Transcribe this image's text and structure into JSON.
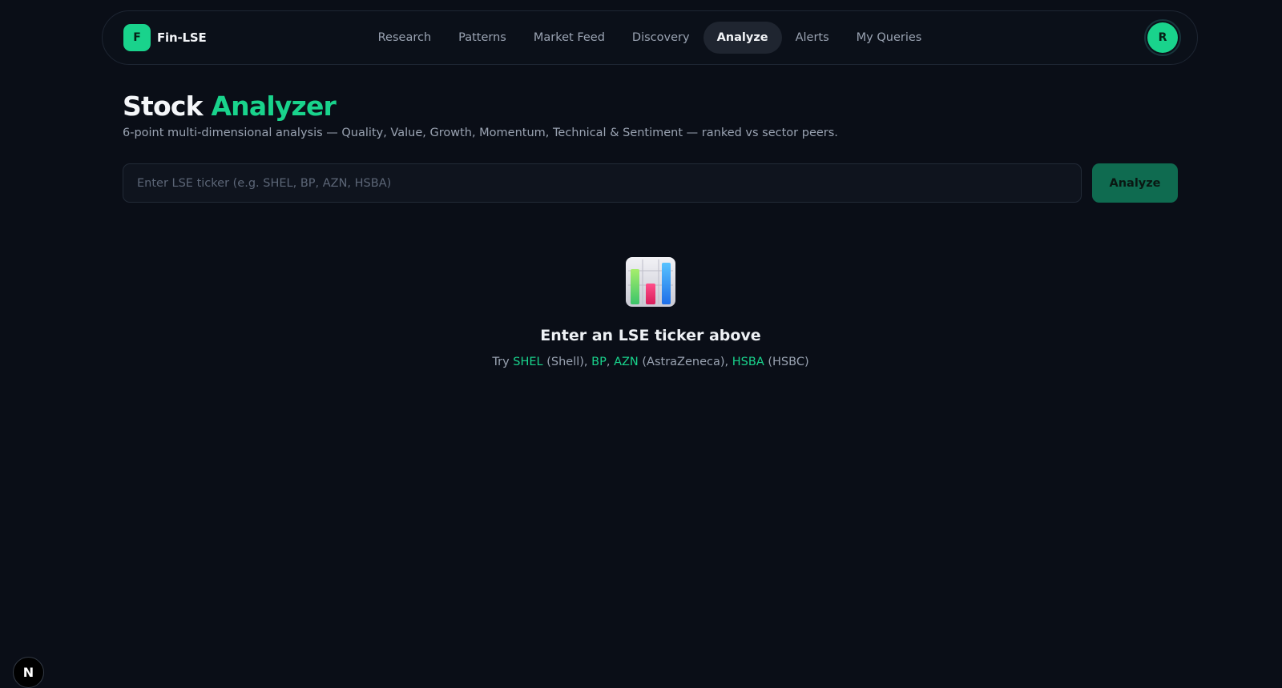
{
  "brand": {
    "badge": "F",
    "name": "Fin-LSE"
  },
  "nav": {
    "items": [
      {
        "label": "Research"
      },
      {
        "label": "Patterns"
      },
      {
        "label": "Market Feed"
      },
      {
        "label": "Discovery"
      },
      {
        "label": "Analyze",
        "active": true
      },
      {
        "label": "Alerts"
      },
      {
        "label": "My Queries"
      }
    ]
  },
  "user": {
    "avatar_initial": "R"
  },
  "header": {
    "title_plain": "Stock",
    "title_accent": "Analyzer",
    "subtitle": "6-point multi-dimensional analysis — Quality, Value, Growth, Momentum, Technical & Sentiment — ranked vs sector peers."
  },
  "search": {
    "placeholder": "Enter LSE ticker (e.g. SHEL, BP, AZN, HSBA)",
    "value": "",
    "button_label": "Analyze"
  },
  "empty_state": {
    "icon": "bar-chart-icon",
    "title": "Enter an LSE ticker above",
    "hint_prefix": "Try ",
    "examples": [
      {
        "ticker": "SHEL",
        "suffix": " (Shell), "
      },
      {
        "ticker": "BP",
        "suffix": ", "
      },
      {
        "ticker": "AZN",
        "suffix": " (AstraZeneca), "
      },
      {
        "ticker": "HSBA",
        "suffix": " (HSBC)"
      }
    ]
  },
  "dev_badge": {
    "label": "N",
    "icon": "nextjs-icon"
  },
  "colors": {
    "background": "#0a0e17",
    "accent": "#19d38c",
    "button": "#0f6b50",
    "muted_text": "#9aa3b2"
  }
}
